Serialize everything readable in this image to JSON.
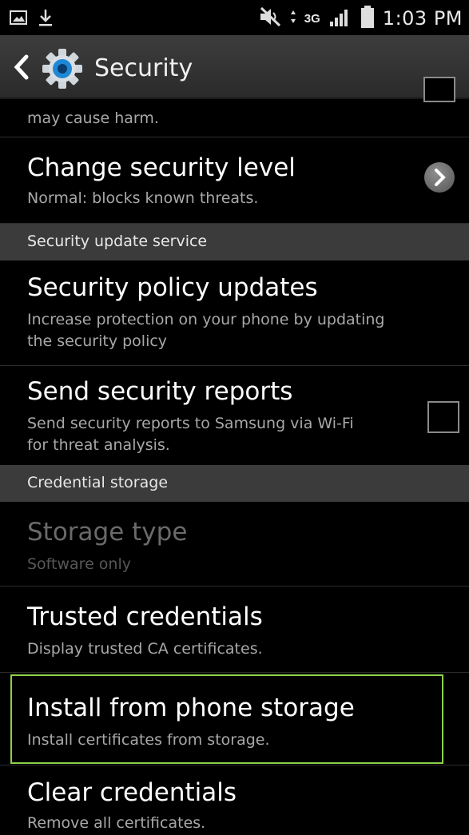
{
  "status_bar": {
    "network": "3G",
    "time": "1:03 PM",
    "icons": [
      "screenshot-icon",
      "download-icon",
      "mute-icon",
      "data-transfer-icon",
      "signal-icon",
      "battery-icon"
    ]
  },
  "action_bar": {
    "title": "Security",
    "back_icon": "chevron-left-icon",
    "app_icon": "gear-icon"
  },
  "rows": {
    "partial": {
      "subtitle": "may cause harm."
    },
    "change_level": {
      "title": "Change security level",
      "subtitle": "Normal: blocks known threats."
    },
    "policy_updates": {
      "title": "Security policy updates",
      "subtitle_1": "Increase protection on your phone by updating",
      "subtitle_2": "the security policy"
    },
    "send_reports": {
      "title": "Send security reports",
      "subtitle_1": "Send security reports to Samsung via Wi-Fi",
      "subtitle_2": "for threat analysis.",
      "checked": false
    },
    "storage_type": {
      "title": "Storage type",
      "subtitle": "Software only"
    },
    "trusted": {
      "title": "Trusted credentials",
      "subtitle": "Display trusted CA certificates."
    },
    "install": {
      "title": "Install from phone storage",
      "subtitle": "Install certificates from storage."
    },
    "clear": {
      "title": "Clear credentials",
      "subtitle": "Remove all certificates."
    }
  },
  "sections": {
    "update_service": "Security update service",
    "credential_storage": "Credential storage"
  },
  "colors": {
    "background": "#000000",
    "section_header": "#3b3b3b",
    "highlight": "#8ed14a",
    "subtitle": "#a8a8a8"
  }
}
